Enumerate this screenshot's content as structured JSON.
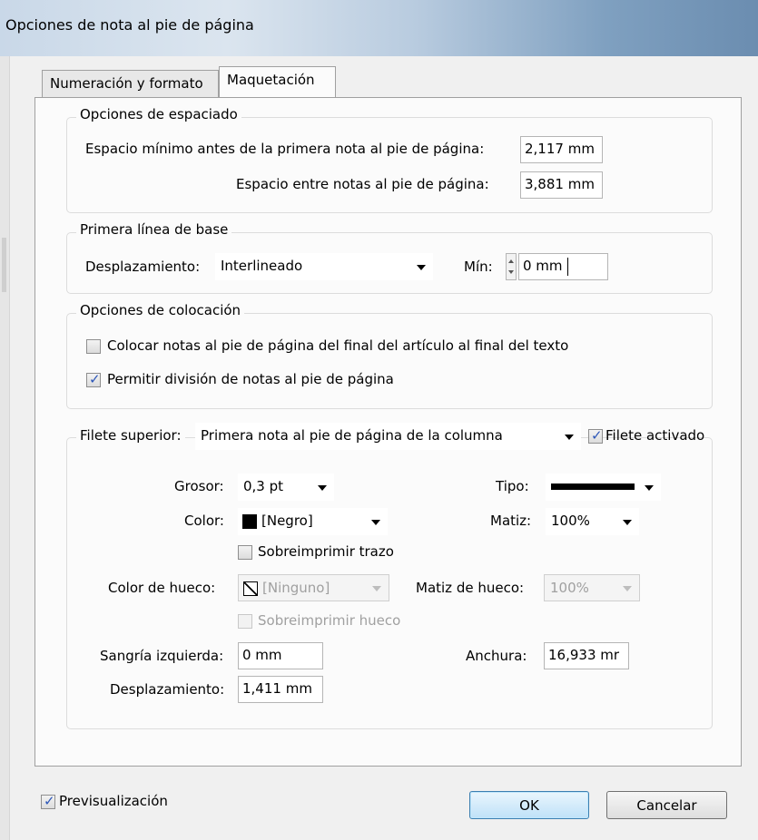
{
  "window": {
    "title": "Opciones de nota al pie de página"
  },
  "tabs": [
    {
      "label": "Numeración y formato",
      "active": false
    },
    {
      "label": "Maquetación",
      "active": true
    }
  ],
  "spacing_group": {
    "title": "Opciones de espaciado",
    "min_space_label": "Espacio mínimo antes de la primera nota al pie de página:",
    "min_space_value": "2,117 mm",
    "between_label": "Espacio entre notas al pie de página:",
    "between_value": "3,881 mm"
  },
  "baseline_group": {
    "title": "Primera línea de base",
    "offset_label": "Desplazamiento:",
    "offset_value": "Interlineado",
    "min_label": "Mín:",
    "min_value": "0 mm"
  },
  "placement_group": {
    "title": "Opciones de colocación",
    "place_at_end_label": "Colocar notas al pie de página del final del artículo al final del texto",
    "place_at_end_checked": false,
    "allow_split_label": "Permitir división de notas al pie de página",
    "allow_split_checked": true
  },
  "rule_group": {
    "rule_above_label": "Filete superior:",
    "rule_above_value": "Primera nota al pie de página de la columna",
    "rule_on_label": "Filete activado",
    "rule_on_checked": true,
    "weight_label": "Grosor:",
    "weight_value": "0,3 pt",
    "type_label": "Tipo:",
    "color_label": "Color:",
    "color_value": "[Negro]",
    "tint_label": "Matiz:",
    "tint_value": "100%",
    "overprint_stroke_label": "Sobreimprimir trazo",
    "overprint_stroke_checked": false,
    "gap_color_label": "Color de hueco:",
    "gap_color_value": "[Ninguno]",
    "gap_tint_label": "Matiz de hueco:",
    "gap_tint_value": "100%",
    "overprint_gap_label": "Sobreimprimir hueco",
    "overprint_gap_checked": false,
    "left_indent_label": "Sangría izquierda:",
    "left_indent_value": "0 mm",
    "width_label": "Anchura:",
    "width_value": "16,933 mr",
    "offset_label": "Desplazamiento:",
    "offset_value": "1,411 mm"
  },
  "footer": {
    "preview_label": "Previsualización",
    "preview_checked": true,
    "ok_label": "OK",
    "cancel_label": "Cancelar"
  },
  "colors": {
    "accent_check": "#2c56b8",
    "default_button": "#3c7fb1"
  },
  "icons": [
    "checkmark-icon",
    "dropdown-arrow-icon",
    "spinner-icon",
    "color-swatch-icon",
    "none-swatch-icon"
  ]
}
